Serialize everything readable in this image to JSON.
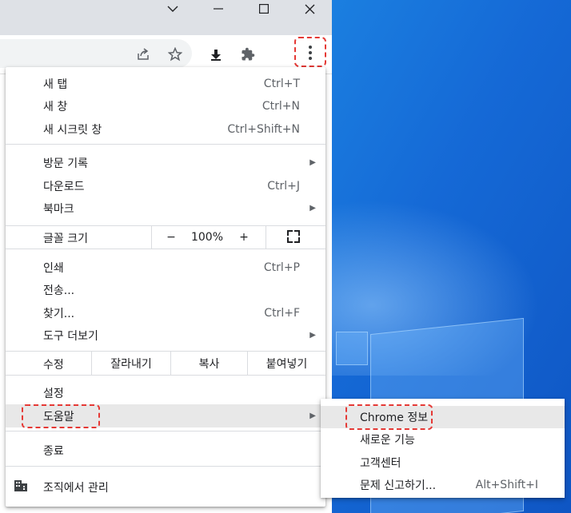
{
  "window": {
    "minimize_icon": "chevron-down",
    "restore_icon": "square",
    "close_icon": "close"
  },
  "toolbar": {
    "share_icon": "share",
    "star_icon": "star",
    "download_icon": "download",
    "extensions_icon": "puzzle",
    "menu_icon": "kebab"
  },
  "menu": {
    "new_tab": {
      "label": "새 탭",
      "shortcut": "Ctrl+T"
    },
    "new_window": {
      "label": "새 창",
      "shortcut": "Ctrl+N"
    },
    "incognito": {
      "label": "새 시크릿 창",
      "shortcut": "Ctrl+Shift+N"
    },
    "history": {
      "label": "방문 기록"
    },
    "downloads": {
      "label": "다운로드",
      "shortcut": "Ctrl+J"
    },
    "bookmarks": {
      "label": "북마크"
    },
    "zoom": {
      "label": "글꼴 크기",
      "minus": "−",
      "value": "100%",
      "plus": "+"
    },
    "print": {
      "label": "인쇄",
      "shortcut": "Ctrl+P"
    },
    "cast": {
      "label": "전송..."
    },
    "find": {
      "label": "찾기...",
      "shortcut": "Ctrl+F"
    },
    "more_tools": {
      "label": "도구 더보기"
    },
    "edit": {
      "label": "수정",
      "cut": "잘라내기",
      "copy": "복사",
      "paste": "붙여넣기"
    },
    "settings": {
      "label": "설정"
    },
    "help": {
      "label": "도움말"
    },
    "exit": {
      "label": "종료"
    },
    "managed": {
      "label": "조직에서 관리"
    }
  },
  "help_submenu": {
    "about": {
      "label": "Chrome 정보"
    },
    "whats_new": {
      "label": "새로운 기능"
    },
    "help_center": {
      "label": "고객센터"
    },
    "report": {
      "label": "문제 신고하기...",
      "shortcut": "Alt+Shift+I"
    }
  },
  "colors": {
    "highlight_border": "#e53935",
    "desktop_blue": "#1569d6",
    "hover_gray": "#e8e8e8"
  }
}
